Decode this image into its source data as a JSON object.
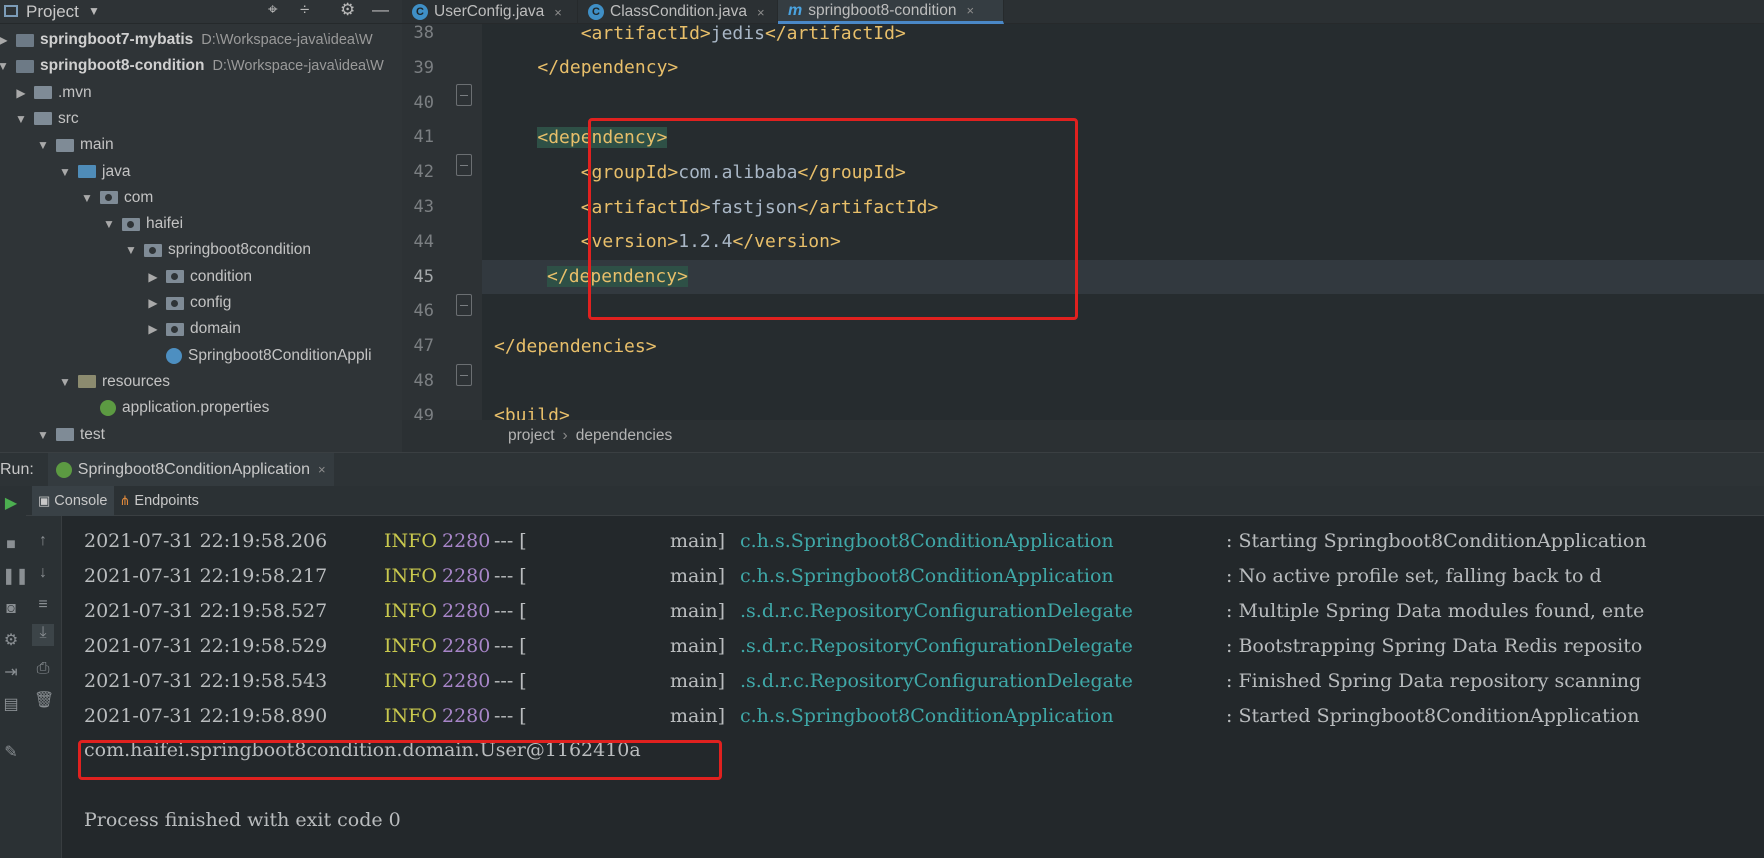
{
  "project_panel": {
    "title": "Project",
    "tree": [
      {
        "label": "springboot7-mybatis",
        "path": "D:\\Workspace-java\\idea\\W",
        "bold": true
      },
      {
        "label": "springboot8-condition",
        "path": "D:\\Workspace-java\\idea\\W",
        "bold": true
      },
      {
        "label": ".mvn"
      },
      {
        "label": "src"
      },
      {
        "label": "main"
      },
      {
        "label": "java"
      },
      {
        "label": "com"
      },
      {
        "label": "haifei"
      },
      {
        "label": "springboot8condition"
      },
      {
        "label": "condition"
      },
      {
        "label": "config"
      },
      {
        "label": "domain"
      },
      {
        "label": "Springboot8ConditionAppli"
      },
      {
        "label": "resources"
      },
      {
        "label": "application.properties"
      },
      {
        "label": "test"
      }
    ]
  },
  "editor": {
    "tabs": [
      {
        "label": "UserConfig.java",
        "icon": "class-icon"
      },
      {
        "label": "ClassCondition.java",
        "icon": "class-icon"
      },
      {
        "label": "springboot8-condition",
        "icon": "maven-icon",
        "active": true
      }
    ],
    "lines": [
      {
        "num": "38",
        "code": "        <artifactId>jedis</artifactId>"
      },
      {
        "num": "39",
        "code": "    </dependency>"
      },
      {
        "num": "40",
        "code": ""
      },
      {
        "num": "41",
        "code": "    <dependency>"
      },
      {
        "num": "42",
        "code": "        <groupId>com.alibaba</groupId>"
      },
      {
        "num": "43",
        "code": "        <artifactId>fastjson</artifactId>"
      },
      {
        "num": "44",
        "code": "        <version>1.2.4</version>"
      },
      {
        "num": "45",
        "code": "    </dependency>"
      },
      {
        "num": "46",
        "code": ""
      },
      {
        "num": "47",
        "code": "</dependencies>"
      },
      {
        "num": "48",
        "code": ""
      },
      {
        "num": "49",
        "code": "<build>"
      }
    ],
    "breadcrumb": [
      "project",
      "dependencies"
    ]
  },
  "run": {
    "label": "Run:",
    "config": "Springboot8ConditionApplication",
    "tabs": [
      "Console",
      "Endpoints"
    ],
    "logs": [
      {
        "ts": "2021-07-31 22:19:58.206",
        "level": "INFO",
        "pid": "2280",
        "sep": "--- [",
        "thread": "main]",
        "cls": "c.h.s.Springboot8ConditionApplication",
        "msg": ": Starting Springboot8ConditionApplication"
      },
      {
        "ts": "2021-07-31 22:19:58.217",
        "level": "INFO",
        "pid": "2280",
        "sep": "--- [",
        "thread": "main]",
        "cls": "c.h.s.Springboot8ConditionApplication",
        "msg": ": No active profile set, falling back to d"
      },
      {
        "ts": "2021-07-31 22:19:58.527",
        "level": "INFO",
        "pid": "2280",
        "sep": "--- [",
        "thread": "main]",
        "cls": ".s.d.r.c.RepositoryConfigurationDelegate",
        "msg": ": Multiple Spring Data modules found, ente"
      },
      {
        "ts": "2021-07-31 22:19:58.529",
        "level": "INFO",
        "pid": "2280",
        "sep": "--- [",
        "thread": "main]",
        "cls": ".s.d.r.c.RepositoryConfigurationDelegate",
        "msg": ": Bootstrapping Spring Data Redis reposito"
      },
      {
        "ts": "2021-07-31 22:19:58.543",
        "level": "INFO",
        "pid": "2280",
        "sep": "--- [",
        "thread": "main]",
        "cls": ".s.d.r.c.RepositoryConfigurationDelegate",
        "msg": ": Finished Spring Data repository scanning"
      },
      {
        "ts": "2021-07-31 22:19:58.890",
        "level": "INFO",
        "pid": "2280",
        "sep": "--- [",
        "thread": "main]",
        "cls": "c.h.s.Springboot8ConditionApplication",
        "msg": ": Started Springboot8ConditionApplication"
      }
    ],
    "output": "com.haifei.springboot8condition.domain.User@1162410a",
    "exit": "Process finished with exit code 0"
  },
  "colors": {
    "highlight_box": "#e0211f",
    "tag": "#e8bf6a",
    "log_level": "#c9c94e",
    "log_class": "#3fa8a8"
  }
}
